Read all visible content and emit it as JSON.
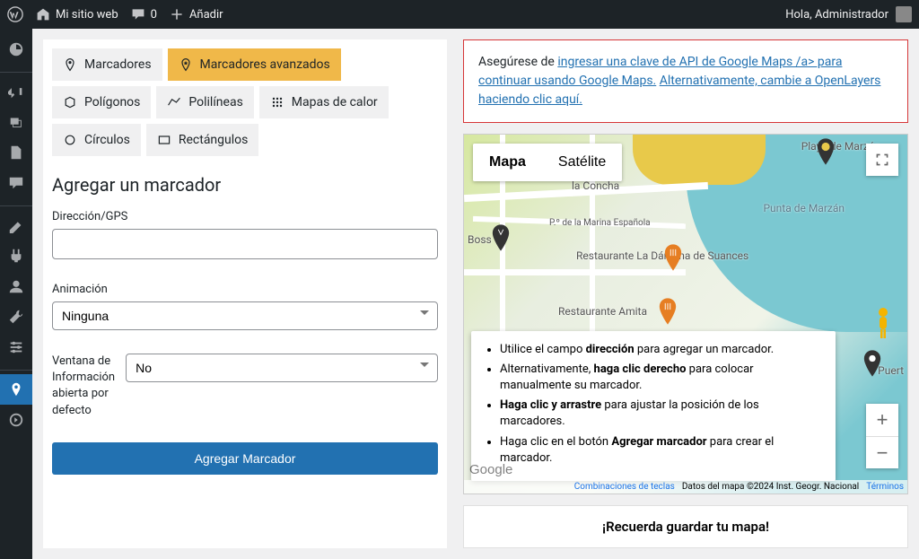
{
  "adminbar": {
    "site_name": "Mi sitio web",
    "comment_count": "0",
    "add_new": "Añadir",
    "greeting": "Hola, Administrador"
  },
  "tabs": {
    "markers": "Marcadores",
    "advanced_markers": "Marcadores avanzados",
    "polygons": "Polígonos",
    "polylines": "Polilíneas",
    "heatmaps": "Mapas de calor",
    "circles": "Círculos",
    "rectangles": "Rectángulos"
  },
  "form": {
    "title": "Agregar un marcador",
    "address_label": "Dirección/GPS",
    "address_value": "",
    "animation_label": "Animación",
    "animation_value": "Ninguna",
    "infowindow_label": "Ventana de Información abierta por defecto",
    "infowindow_value": "No",
    "submit_label": "Agregar Marcador"
  },
  "warning": {
    "prefix": "Asegúrese de ",
    "link1": "ingresar una clave de API de Google Maps /a> para continuar usando Google Maps.",
    "mid": " ",
    "link2": "Alternativamente, cambie a OpenLayers haciendo clic aquí."
  },
  "map": {
    "map_label": "Mapa",
    "satellite_label": "Satélite",
    "google_logo": "Google",
    "attrib_shortcuts": "Combinaciones de teclas",
    "attrib_data": "Datos del mapa ©2024 Inst. Geogr. Nacional",
    "attrib_terms": "Términos",
    "pois": {
      "playa_marzan": "Playa de Marzán",
      "la_concha": "la Concha",
      "punta_marzan": "Punta de Marzán",
      "boss": "Boss",
      "darsena": "Restaurante La Dársena de Suances",
      "amita": "Restaurante Amita",
      "marina": "P.º de la Marina Española",
      "puert": "Puert"
    }
  },
  "tips": {
    "t1a": "Utilice el campo ",
    "t1b": "dirección",
    "t1c": " para agregar un marcador.",
    "t2a": "Alternativamente, ",
    "t2b": "haga clic derecho",
    "t2c": " para colocar manualmente su marcador.",
    "t3a": "Haga clic y arrastre",
    "t3b": " para ajustar la posición de los marcadores.",
    "t4a": "Haga clic en el botón ",
    "t4b": "Agregar marcador",
    "t4c": " para crear el marcador."
  },
  "save_banner": "¡Recuerda guardar tu mapa!"
}
